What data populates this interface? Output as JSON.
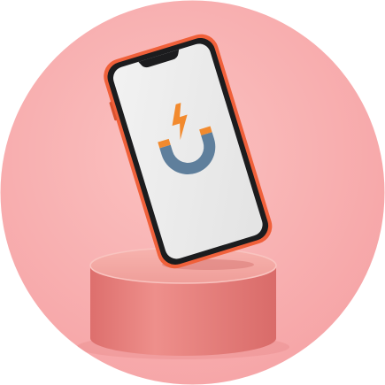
{
  "scene": {
    "subject": "smartphone-on-pedestal",
    "logo_icon": "magnet-lightning-icon",
    "colors": {
      "background_circle": "#f9b1b1",
      "pedestal": "#e8817e",
      "pedestal_top": "#f4a7a2",
      "phone_frame": "#f0603a",
      "phone_bezel": "#1c1c1e",
      "screen": "#ececec",
      "logo_bolt": "#f28a2e",
      "logo_magnet": "#5f7f9c",
      "logo_magnet_tips": "#f28a2e"
    }
  }
}
